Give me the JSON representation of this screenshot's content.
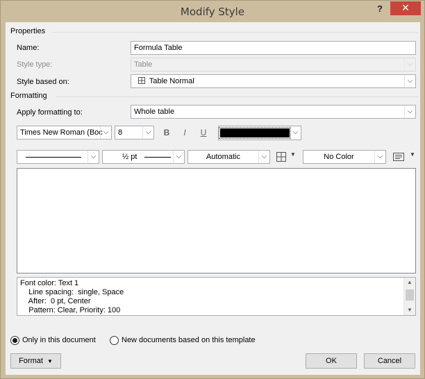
{
  "window": {
    "title": "Modify Style",
    "help_label": "?",
    "close_label": "✕"
  },
  "properties": {
    "group_label": "Properties",
    "name": {
      "label": "Name:",
      "value": "Formula Table"
    },
    "style_type": {
      "label": "Style type:",
      "value": "Table"
    },
    "style_based_on": {
      "label": "Style based on:",
      "value": "Table Normal",
      "icon": "table-grid-icon"
    }
  },
  "formatting": {
    "group_label": "Formatting",
    "apply_to": {
      "label": "Apply formatting to:",
      "value": "Whole table"
    },
    "font_name": "Times New Roman (Boc",
    "font_size": "8",
    "bold_label": "B",
    "italic_label": "I",
    "underline_label": "U",
    "font_color": "#000000",
    "border_line_width": "½ pt",
    "border_color": "Automatic",
    "shading": "No Color"
  },
  "description": {
    "lines": [
      "Font color: Text 1",
      "    Line spacing:  single, Space",
      "    After:  0 pt, Center",
      "    Pattern: Clear, Priority: 100"
    ]
  },
  "options": {
    "only_this_doc": "Only in this document",
    "only_this_doc_selected": true,
    "new_docs": "New documents based on this template",
    "new_docs_selected": false
  },
  "buttons": {
    "format": "Format",
    "ok": "OK",
    "cancel": "Cancel"
  },
  "colors": {
    "title_bar": "#cdbd9f",
    "close_button": "#c7463b",
    "dialog_bg": "#f0f0f0"
  }
}
